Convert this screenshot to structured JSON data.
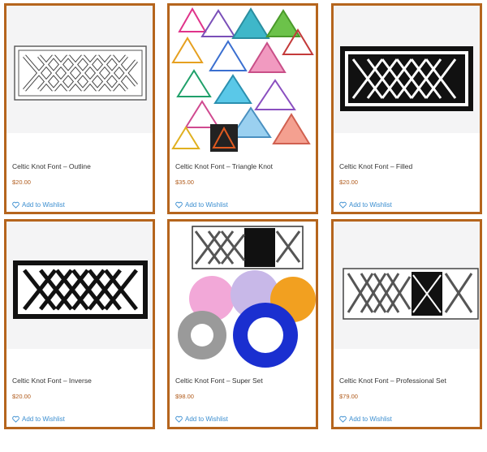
{
  "accent_color": "#b5651d",
  "price_color": "#b05a1a",
  "link_color": "#3b8ed0",
  "products": [
    {
      "title": "Celtic Knot Font – Outline",
      "price": "$20.00",
      "wishlist": "Add to Wishlist",
      "image": "celtic-knot-outline"
    },
    {
      "title": "Celtic Knot Font – Triangle Knot",
      "price": "$35.00",
      "wishlist": "Add to Wishlist",
      "image": "celtic-triangle-knots"
    },
    {
      "title": "Celtic Knot Font – Filled",
      "price": "$20.00",
      "wishlist": "Add to Wishlist",
      "image": "celtic-knot-filled"
    },
    {
      "title": "Celtic Knot Font – Inverse",
      "price": "$20.00",
      "wishlist": "Add to Wishlist",
      "image": "celtic-knot-inverse"
    },
    {
      "title": "Celtic Knot Font – Super Set",
      "price": "$98.00",
      "wishlist": "Add to Wishlist",
      "image": "celtic-knot-super-set"
    },
    {
      "title": "Celtic Knot Font – Professional Set",
      "price": "$79.00",
      "wishlist": "Add to Wishlist",
      "image": "celtic-knot-professional-set"
    }
  ]
}
